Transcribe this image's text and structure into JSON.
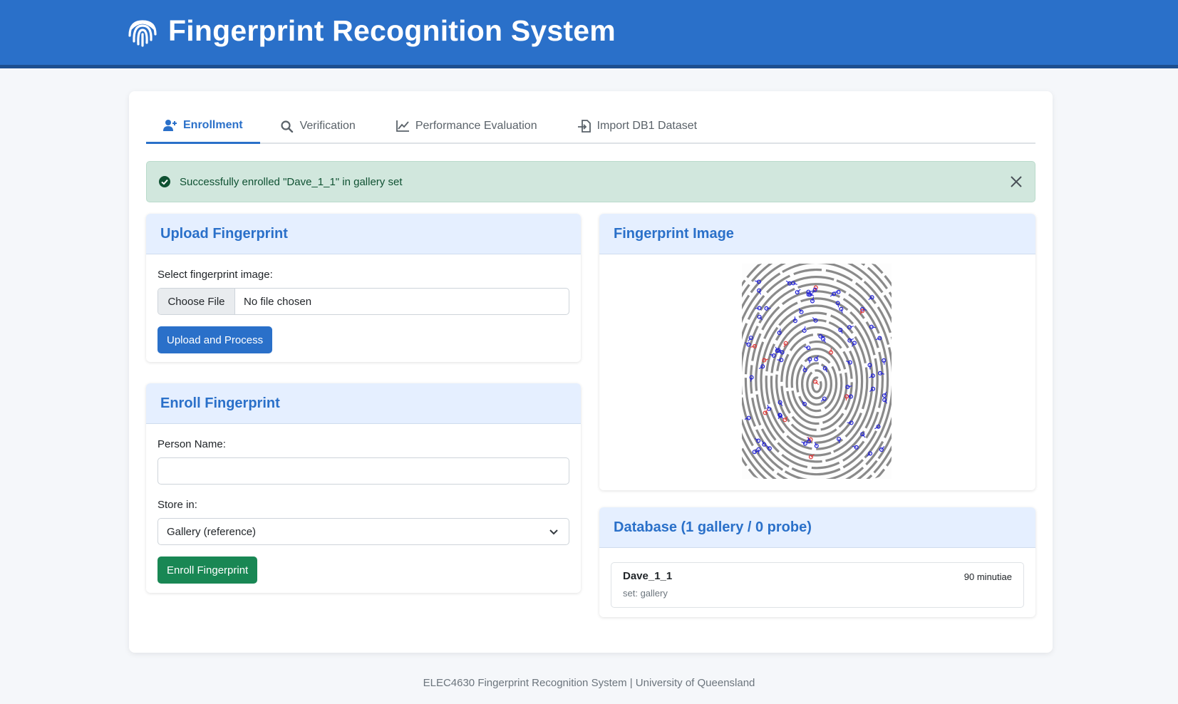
{
  "header": {
    "title": "Fingerprint Recognition System",
    "logo_icon": "fingerprint-icon"
  },
  "tabs": [
    {
      "label": "Enrollment",
      "icon": "user-plus-icon",
      "active": true
    },
    {
      "label": "Verification",
      "icon": "search-icon",
      "active": false
    },
    {
      "label": "Performance Evaluation",
      "icon": "chart-line-icon",
      "active": false
    },
    {
      "label": "Import DB1 Dataset",
      "icon": "file-import-icon",
      "active": false
    }
  ],
  "alert": {
    "message": "Successfully enrolled \"Dave_1_1\" in gallery set",
    "type": "success"
  },
  "upload": {
    "title": "Upload Fingerprint",
    "select_label": "Select fingerprint image:",
    "choose_button": "Choose File",
    "file_status": "No file chosen",
    "submit": "Upload and Process"
  },
  "enroll": {
    "title": "Enroll Fingerprint",
    "name_label": "Person Name:",
    "name_value": "",
    "store_label": "Store in:",
    "store_value": "Gallery (reference)",
    "submit": "Enroll Fingerprint"
  },
  "image_panel": {
    "title": "Fingerprint Image"
  },
  "database": {
    "title": "Database (1 gallery / 0 probe)",
    "items": [
      {
        "name": "Dave_1_1",
        "set": "set: gallery",
        "count": "90 minutiae"
      }
    ]
  },
  "footer": {
    "text": "ELEC4630 Fingerprint Recognition System | University of Queensland"
  },
  "colors": {
    "primary": "#2a70c9",
    "success": "#198754",
    "alert_bg": "#d1e7dd"
  }
}
